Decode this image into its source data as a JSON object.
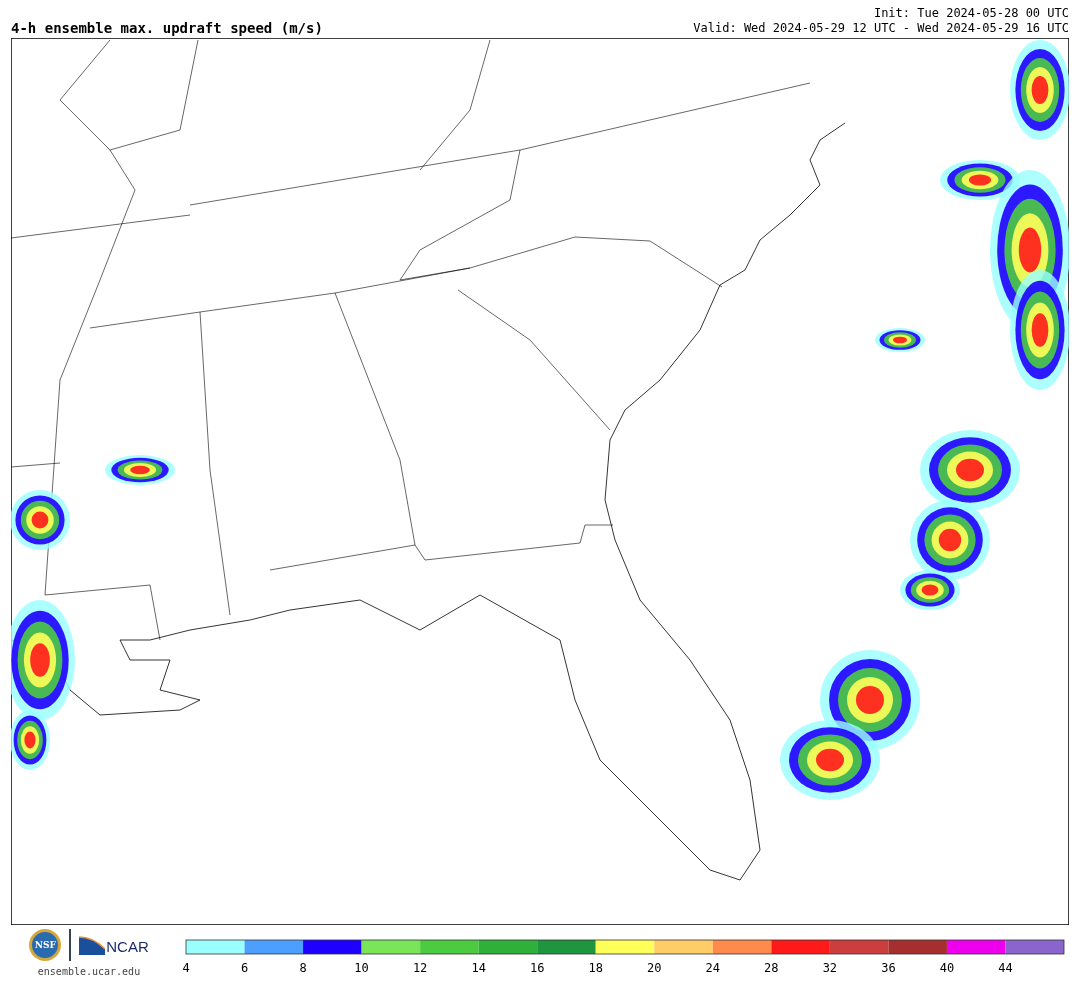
{
  "title": "4-h ensemble max. updraft speed (m/s)",
  "init": "Init: Tue 2024-05-28 00 UTC",
  "valid": "Valid: Wed 2024-05-29 12 UTC - Wed 2024-05-29 16 UTC",
  "logos": {
    "nsf": "NSF",
    "ncar": "NCAR",
    "site": "ensemble.ucar.edu"
  },
  "legend": {
    "bins": [
      {
        "color": "#99ffff",
        "label": "4"
      },
      {
        "color": "#4c9eff",
        "label": "6"
      },
      {
        "color": "#1e00ff",
        "label": "8"
      },
      {
        "color": "#7be55a",
        "label": "10"
      },
      {
        "color": "#4ccb40",
        "label": "12"
      },
      {
        "color": "#2eb03a",
        "label": "14"
      },
      {
        "color": "#1f9540",
        "label": "16"
      },
      {
        "color": "#ffff5a",
        "label": "18"
      },
      {
        "color": "#ffcc66",
        "label": "20"
      },
      {
        "color": "#ff8a4c",
        "label": "24"
      },
      {
        "color": "#ff1a1a",
        "label": "28"
      },
      {
        "color": "#cc3d3d",
        "label": "32"
      },
      {
        "color": "#a52f2f",
        "label": "36"
      },
      {
        "color": "#ee00ee",
        "label": "40"
      },
      {
        "color": "#8a66cc",
        "label": "44"
      }
    ]
  }
}
